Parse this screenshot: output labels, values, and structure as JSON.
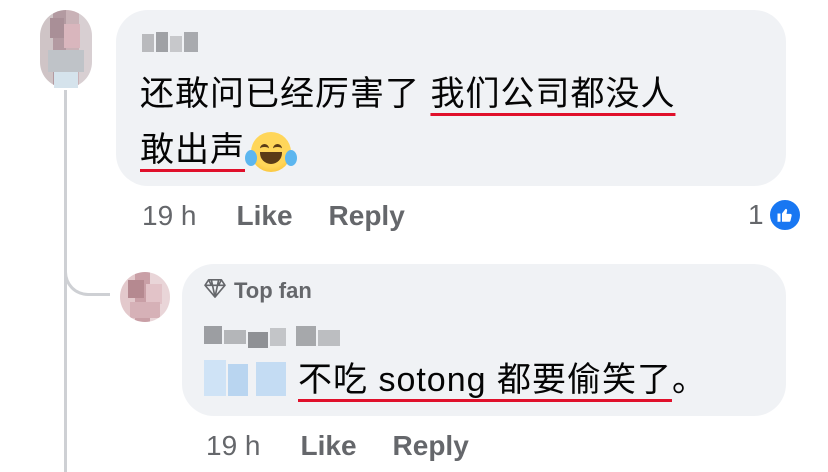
{
  "comment1": {
    "line1_plain": "还敢问已经厉害了 ",
    "line1_underlined": "我们公司都没人",
    "line2_underlined": "敢出声",
    "emoji": "laughing-tears-emoji",
    "time": "19 h",
    "like_label": "Like",
    "reply_label": "Reply",
    "reaction_count": "1",
    "reaction_icon": "thumbs-up-icon"
  },
  "reply1": {
    "badge_label": "Top fan",
    "badge_icon": "diamond-icon",
    "text_underlined": "不吃 sotong 都要偷笑了",
    "text_tail": "。",
    "time": "19 h",
    "like_label": "Like",
    "reply_label": "Reply"
  },
  "colors": {
    "bubble": "#f0f2f5",
    "meta_text": "#65676b",
    "underline_red": "#e0102b",
    "like_blue": "#1877f2"
  }
}
